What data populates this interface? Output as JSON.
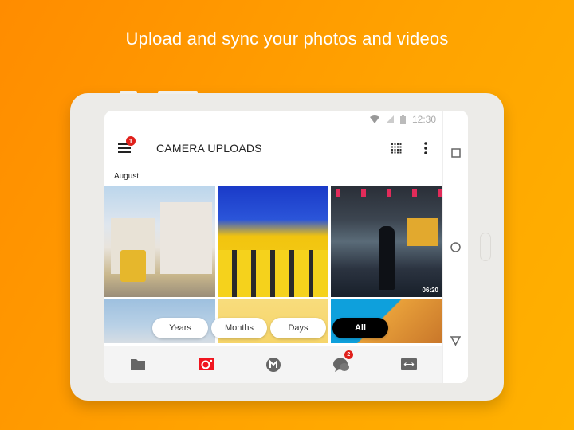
{
  "headline": "Upload and sync your photos and videos",
  "status_bar": {
    "time": "12:30",
    "icons": [
      "wifi-icon",
      "signal-icon",
      "battery-icon"
    ]
  },
  "toolbar": {
    "title": "CAMERA UPLOADS",
    "menu_badge": "1",
    "icons": [
      "menu-icon",
      "grid-view-icon",
      "more-vert-icon"
    ]
  },
  "section_label": "August",
  "photos": [
    {
      "subject": "tram-street"
    },
    {
      "subject": "yellow-palace"
    },
    {
      "subject": "train-station",
      "duration": "06:20"
    },
    {
      "subject": "dome-sky"
    },
    {
      "subject": "yellow-wall"
    },
    {
      "subject": "orange-building"
    }
  ],
  "view_filters": [
    {
      "label": "Years",
      "active": false
    },
    {
      "label": "Months",
      "active": false
    },
    {
      "label": "Days",
      "active": false
    },
    {
      "label": "All",
      "active": true
    }
  ],
  "bottom_nav": [
    {
      "name": "cloud-drive",
      "icon": "folder-icon"
    },
    {
      "name": "camera-uploads",
      "icon": "camera-icon",
      "active": true
    },
    {
      "name": "home",
      "icon": "mega-icon"
    },
    {
      "name": "chat",
      "icon": "chat-icon",
      "badge": "2"
    },
    {
      "name": "transfers",
      "icon": "transfers-icon"
    }
  ],
  "system_nav": [
    "recents-icon",
    "home-circle-icon",
    "back-icon"
  ],
  "colors": {
    "accent": "#f0151f",
    "badge": "#e0201b",
    "active_pill": "#000000",
    "background": "#ff9a00"
  }
}
